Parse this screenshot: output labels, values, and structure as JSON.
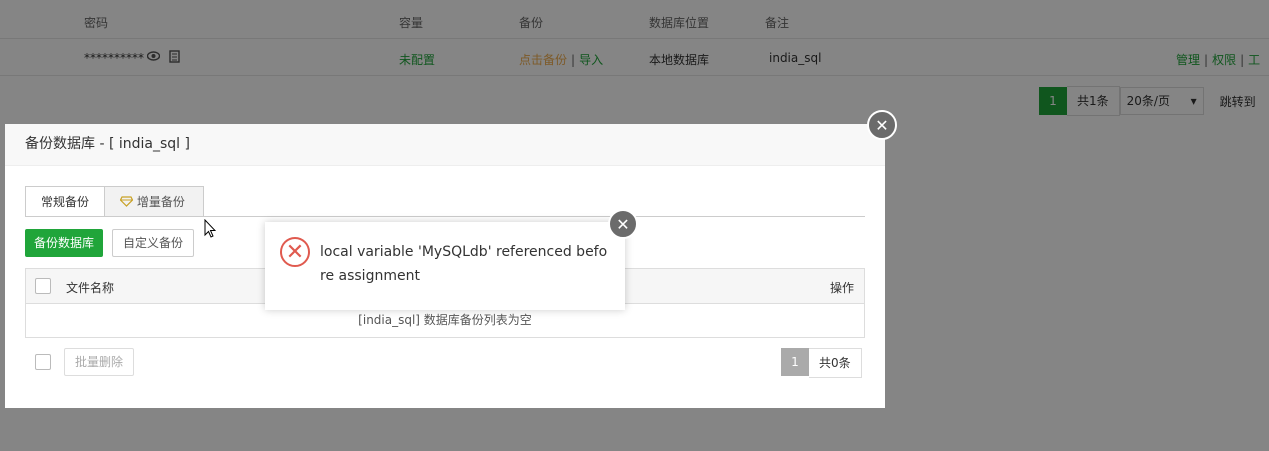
{
  "table": {
    "headers": {
      "password": "密码",
      "capacity": "容量",
      "backup": "备份",
      "location": "数据库位置",
      "remark": "备注"
    },
    "row": {
      "password_mask": "**********",
      "capacity": "未配置",
      "backup_link": "点击备份",
      "import_link": "导入",
      "location": "本地数据库",
      "remark": "india_sql",
      "actions": [
        "管理",
        "权限",
        "工"
      ]
    }
  },
  "pager": {
    "current": "1",
    "total": "共1条",
    "page_size": "20条/页",
    "jump": "跳转到"
  },
  "backup_dialog": {
    "title": "备份数据库 - [ india_sql ]",
    "tabs": [
      "常规备份",
      "增量备份"
    ],
    "buttons": {
      "backup_db": "备份数据库",
      "custom_backup": "自定义备份",
      "batch_delete": "批量删除"
    },
    "list": {
      "col_filename": "文件名称",
      "col_action": "操作",
      "empty_text": "[india_sql] 数据库备份列表为空"
    },
    "pager": {
      "current": "1",
      "total": "共0条"
    }
  },
  "error_message": {
    "text": "local variable 'MySQLdb' referenced before assignment"
  },
  "icons": {
    "eye": "eye-icon",
    "copy": "copy-icon",
    "diamond": "diamond-icon",
    "error": "error-icon",
    "close": "close-icon",
    "cursor": "mouse-cursor-icon"
  },
  "colors": {
    "accent": "#20a53a",
    "warning": "#f0ad4e",
    "error": "#e05a4f"
  }
}
